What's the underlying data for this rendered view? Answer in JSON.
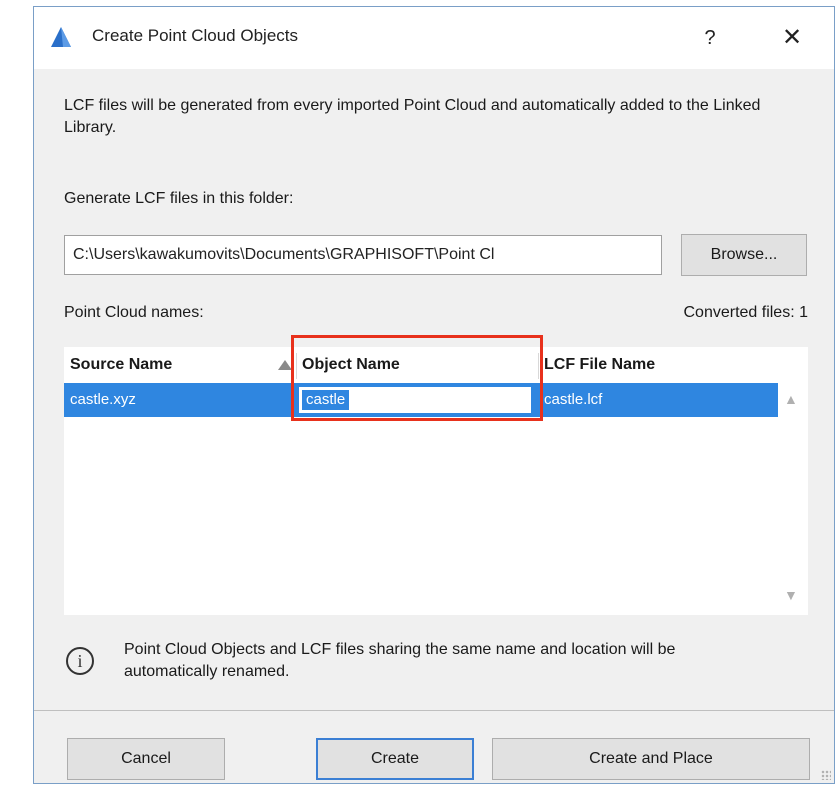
{
  "window": {
    "title": "Create Point Cloud Objects",
    "help_glyph": "?",
    "close_glyph": "✕",
    "app_icon": "archicad-logo-icon"
  },
  "intro_text": "LCF files will be generated from every imported Point Cloud and automatically added to the Linked Library.",
  "folder": {
    "label": "Generate LCF files in this folder:",
    "path": "C:\\Users\\kawakumovits\\Documents\\GRAPHISOFT\\Point Cl",
    "browse_label": "Browse..."
  },
  "names": {
    "label": "Point Cloud names:",
    "converted": "Converted files: 1"
  },
  "table": {
    "columns": [
      "Source Name",
      "Object Name",
      "LCF File Name"
    ],
    "rows": [
      {
        "source": "castle.xyz",
        "object": "castle",
        "lcf": "castle.lcf",
        "selected": true
      }
    ]
  },
  "note": {
    "icon": "info-icon",
    "text": "Point Cloud Objects and LCF files sharing the same name and location will be automatically renamed."
  },
  "buttons": {
    "cancel": "Cancel",
    "create": "Create",
    "create_and_place": "Create and Place"
  },
  "colors": {
    "selection": "#2f86e0",
    "highlight": "#e8311c",
    "default_button_border": "#3b7fd4"
  }
}
